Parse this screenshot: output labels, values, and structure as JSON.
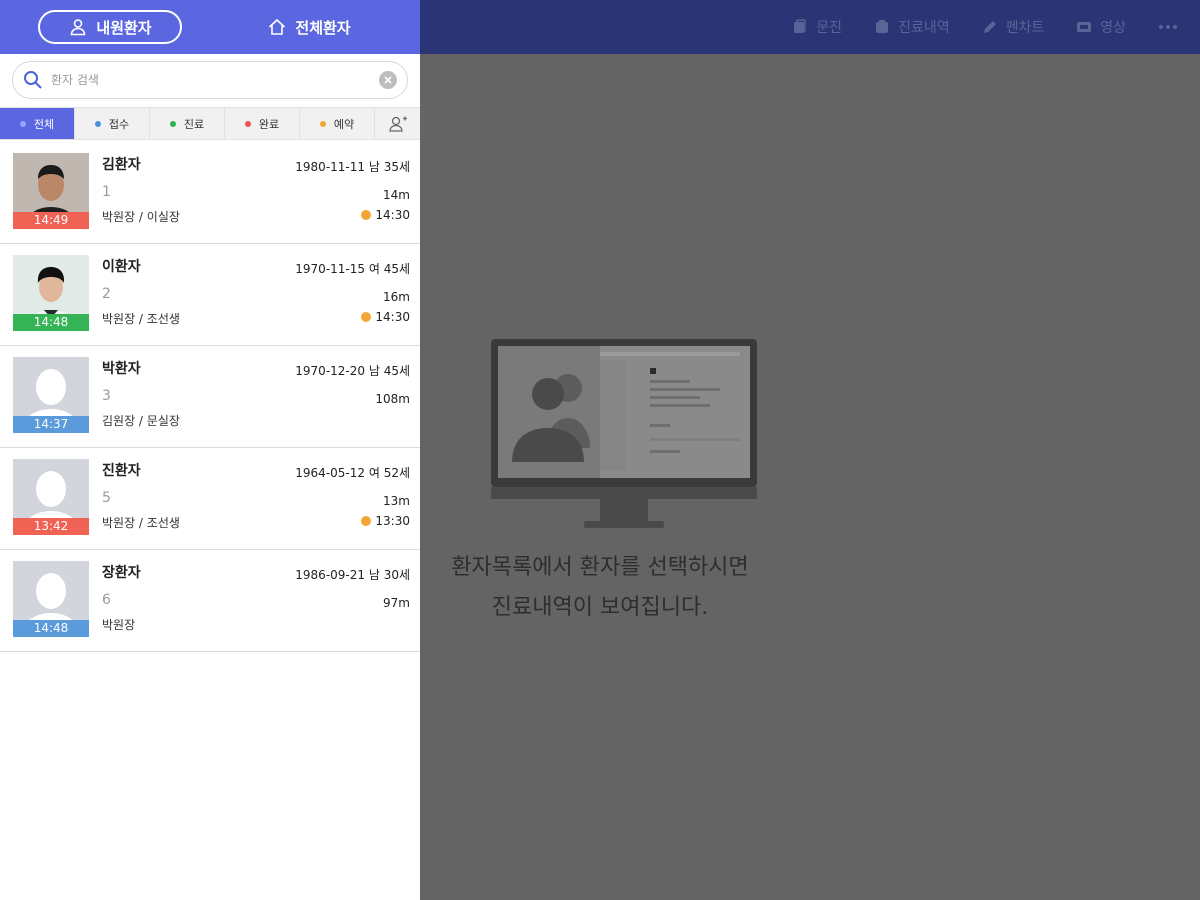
{
  "header": {
    "tab_inpatients": "내원환자",
    "tab_allpatients": "전체환자"
  },
  "search": {
    "placeholder": "환자 검색"
  },
  "filters": [
    {
      "label": "전체",
      "color": "#9aa3ff",
      "active": true
    },
    {
      "label": "접수",
      "color": "#4a90d9",
      "active": false
    },
    {
      "label": "진료",
      "color": "#2db34a",
      "active": false
    },
    {
      "label": "완료",
      "color": "#ef5350",
      "active": false
    },
    {
      "label": "예약",
      "color": "#f2a735",
      "active": false
    }
  ],
  "patients": [
    {
      "name": "김환자",
      "number": "1",
      "doctors": "박원장 / 이실장",
      "dob_info": "1980-11-11 남 35세",
      "wait": "14m",
      "appointment": "14:30",
      "time": "14:49",
      "time_color": "#ef6254",
      "photo": "man-dark-shirt"
    },
    {
      "name": "이환자",
      "number": "2",
      "doctors": "박원장 / 조선생",
      "dob_info": "1970-11-15 여 45세",
      "wait": "16m",
      "appointment": "14:30",
      "time": "14:48",
      "time_color": "#35b456",
      "photo": "young-man-white-shirt"
    },
    {
      "name": "박환자",
      "number": "3",
      "doctors": "김원장 / 문실장",
      "dob_info": "1970-12-20 남 45세",
      "wait": "108m",
      "appointment": "",
      "time": "14:37",
      "time_color": "#5b9bdb",
      "photo": "placeholder"
    },
    {
      "name": "진환자",
      "number": "5",
      "doctors": "박원장 / 조선생",
      "dob_info": "1964-05-12 여 52세",
      "wait": "13m",
      "appointment": "13:30",
      "time": "13:42",
      "time_color": "#ef6254",
      "photo": "placeholder"
    },
    {
      "name": "장환자",
      "number": "6",
      "doctors": "박원장",
      "dob_info": "1986-09-21 남 30세",
      "wait": "97m",
      "appointment": "",
      "time": "14:48",
      "time_color": "#5b9bdb",
      "photo": "placeholder"
    }
  ],
  "toolbar": {
    "consult": "문진",
    "records": "진료내역",
    "penchart": "펜차트",
    "video": "영상"
  },
  "empty_state": {
    "line1": "환자목록에서 환자를 선택하시면",
    "line2": "진료내역이 보여집니다."
  },
  "icons": {
    "user": "user-icon",
    "home": "home-icon",
    "search": "search-icon",
    "clear": "clear-icon",
    "add_user": "add-user-icon",
    "clock": "clock-icon",
    "more": "more-icon"
  }
}
